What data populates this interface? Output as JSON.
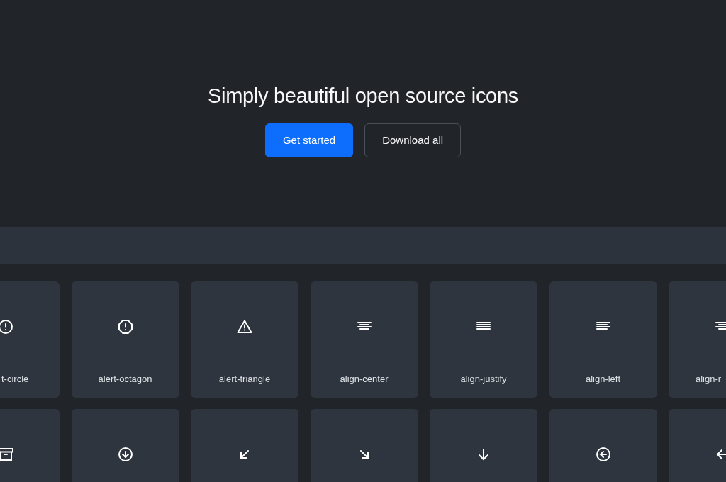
{
  "hero": {
    "title": "Simply beautiful open source icons",
    "buttons": [
      {
        "label": "Get started",
        "kind": "primary"
      },
      {
        "label": "Download all",
        "kind": "outline"
      }
    ]
  },
  "icons": [
    {
      "kind": "alert-circle",
      "name": "t-circle"
    },
    {
      "kind": "alert-octagon",
      "name": "alert-octagon"
    },
    {
      "kind": "alert-triangle",
      "name": "alert-triangle"
    },
    {
      "kind": "align-center",
      "name": "align-center"
    },
    {
      "kind": "align-justify",
      "name": "align-justify"
    },
    {
      "kind": "align-left",
      "name": "align-left"
    },
    {
      "kind": "align-right",
      "name": "align-r"
    },
    {
      "kind": "archive"
    },
    {
      "kind": "arrow-down-circle"
    },
    {
      "kind": "arrow-down-left"
    },
    {
      "kind": "arrow-down-right"
    },
    {
      "kind": "arrow-down"
    },
    {
      "kind": "arrow-left-circle"
    },
    {
      "kind": "arrow-left"
    }
  ]
}
